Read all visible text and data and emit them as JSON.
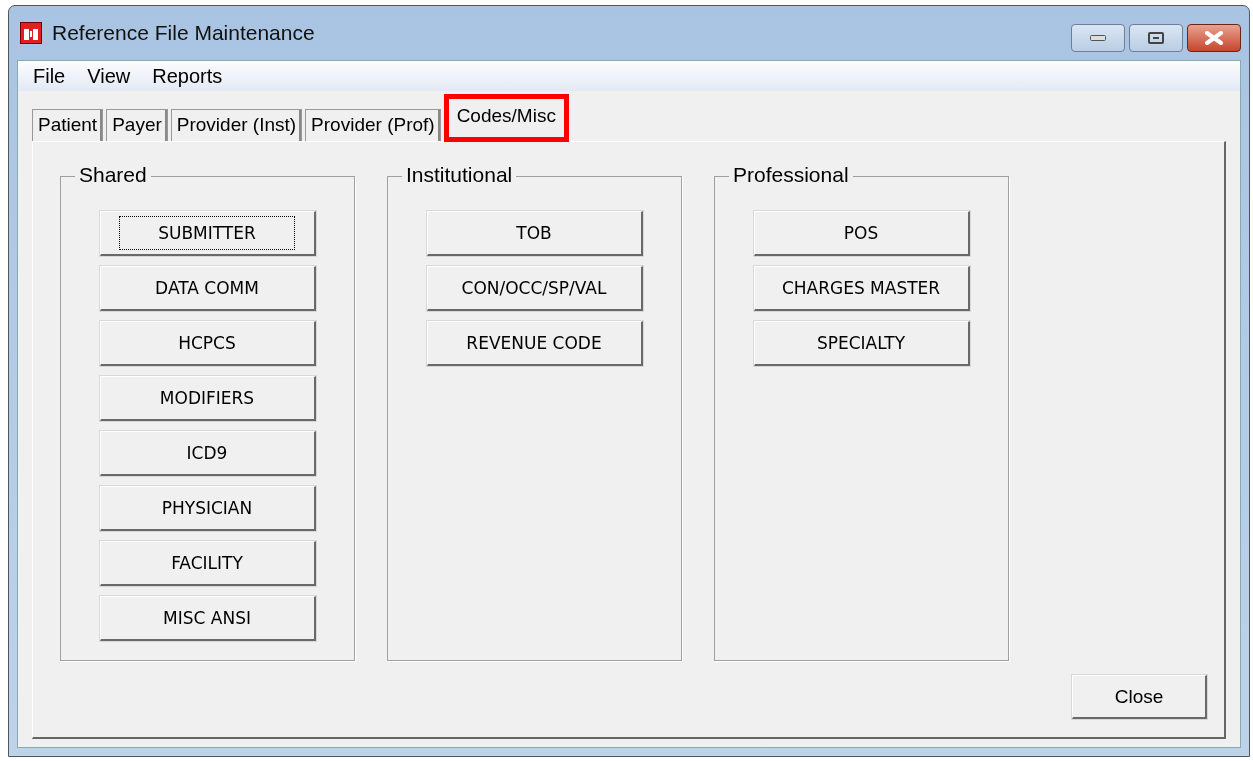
{
  "window": {
    "title": "Reference File Maintenance"
  },
  "menu": [
    "File",
    "View",
    "Reports"
  ],
  "tabs": [
    {
      "label": "Patient",
      "selected": false,
      "highlighted": false
    },
    {
      "label": "Payer",
      "selected": false,
      "highlighted": false
    },
    {
      "label": "Provider (Inst)",
      "selected": false,
      "highlighted": false
    },
    {
      "label": "Provider (Prof)",
      "selected": false,
      "highlighted": false
    },
    {
      "label": "Codes/Misc",
      "selected": true,
      "highlighted": true
    }
  ],
  "groups": [
    {
      "title": "Shared",
      "buttons": [
        {
          "label": "SUBMITTER",
          "focused": true
        },
        {
          "label": "DATA COMM",
          "focused": false
        },
        {
          "label": "HCPCS",
          "focused": false
        },
        {
          "label": "MODIFIERS",
          "focused": false
        },
        {
          "label": "ICD9",
          "focused": false
        },
        {
          "label": "PHYSICIAN",
          "focused": false
        },
        {
          "label": "FACILITY",
          "focused": false
        },
        {
          "label": "MISC ANSI",
          "focused": false
        }
      ]
    },
    {
      "title": "Institutional",
      "buttons": [
        {
          "label": "TOB",
          "focused": false
        },
        {
          "label": "CON/OCC/SP/VAL",
          "focused": false
        },
        {
          "label": "REVENUE CODE",
          "focused": false
        }
      ]
    },
    {
      "title": "Professional",
      "buttons": [
        {
          "label": "POS",
          "focused": false
        },
        {
          "label": "CHARGES MASTER",
          "focused": false
        },
        {
          "label": "SPECIALTY",
          "focused": false
        }
      ]
    }
  ],
  "close_button": {
    "label": "Close"
  }
}
